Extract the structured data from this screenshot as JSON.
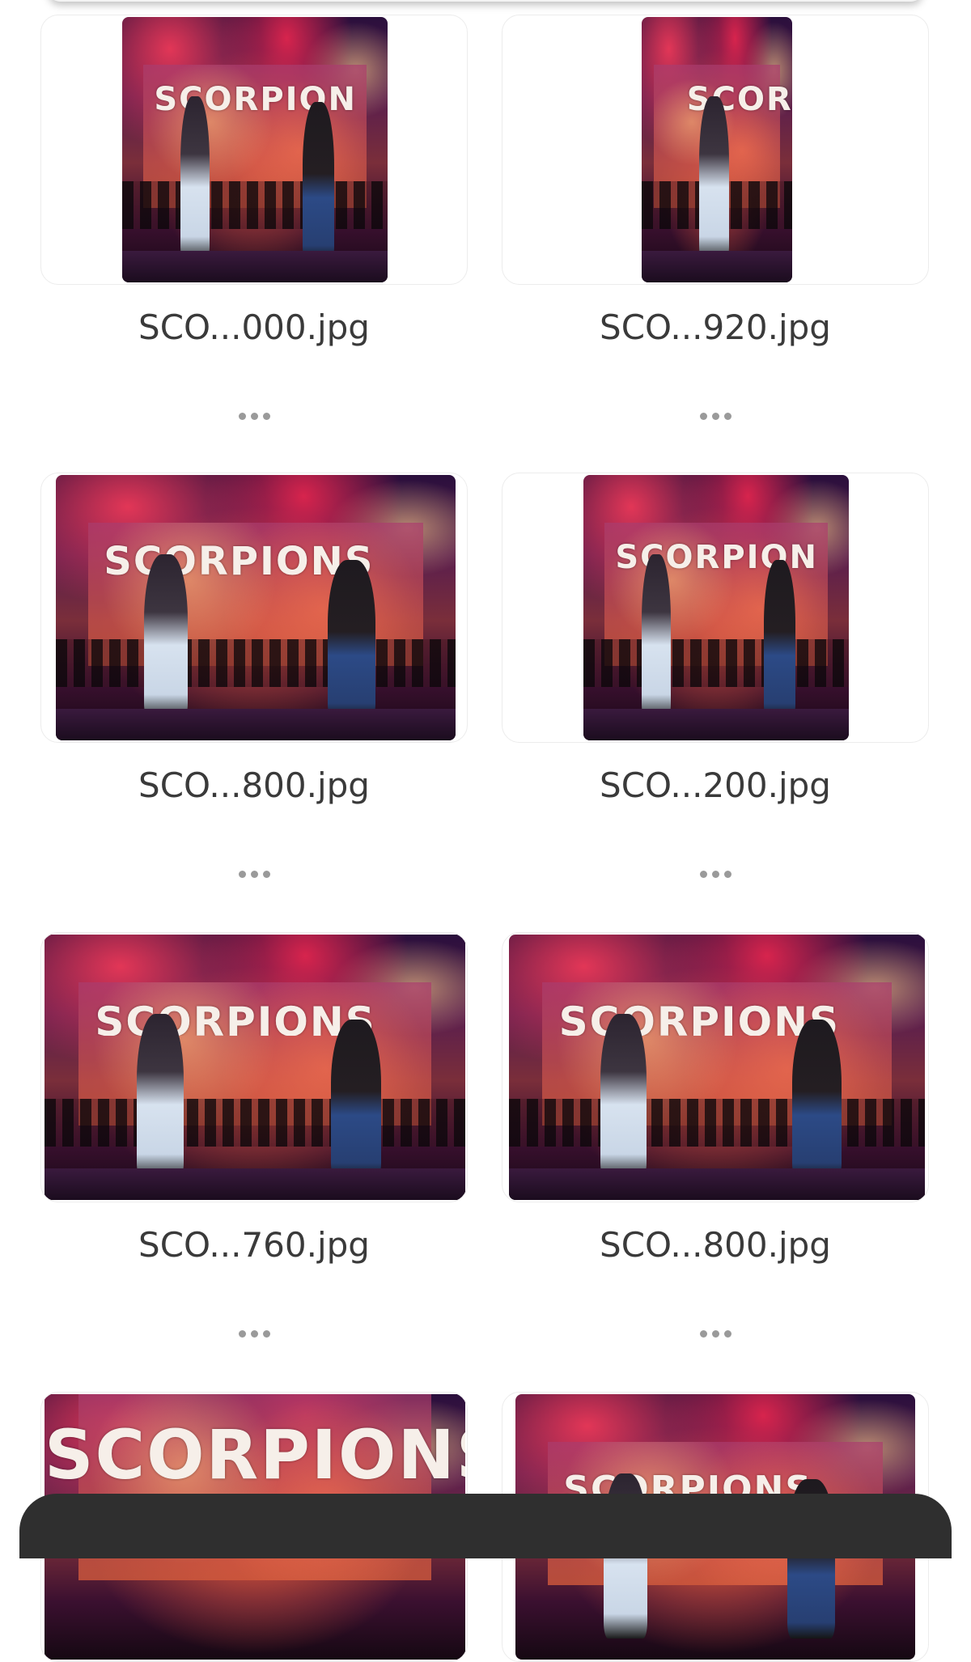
{
  "files": [
    {
      "name": "SCO...000.jpg"
    },
    {
      "name": "SCO...920.jpg"
    },
    {
      "name": "SCO...800.jpg"
    },
    {
      "name": "SCO...200.jpg"
    },
    {
      "name": "SCO...760.jpg"
    },
    {
      "name": "SCO...800.jpg"
    },
    {
      "name": ""
    },
    {
      "name": ""
    }
  ],
  "photo": {
    "logo_text": "SCORPIONS"
  },
  "icons": {
    "more": "more-horizontal-icon"
  },
  "colors": {
    "text": "#3a3a3a",
    "more_dots": "#9a9a9a",
    "bottom_sheet": "#2f2f2f"
  }
}
